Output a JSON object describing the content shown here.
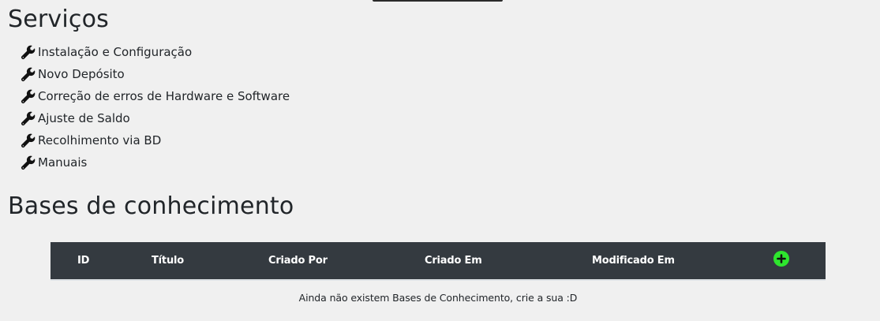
{
  "services": {
    "title": "Serviços",
    "items": [
      {
        "label": "Instalação e Configuração",
        "icon": "wrench-icon"
      },
      {
        "label": "Novo Depósito",
        "icon": "wrench-icon"
      },
      {
        "label": "Correção de erros de Hardware e Software",
        "icon": "wrench-icon"
      },
      {
        "label": "Ajuste de Saldo",
        "icon": "wrench-icon"
      },
      {
        "label": "Recolhimento via BD",
        "icon": "wrench-icon"
      },
      {
        "label": "Manuais",
        "icon": "wrench-icon"
      }
    ]
  },
  "knowledge_base": {
    "title": "Bases de conhecimento",
    "columns": [
      "ID",
      "Título",
      "Criado Por",
      "Criado Em",
      "Modificado Em"
    ],
    "add_icon": "plus-circle-icon",
    "empty_message": "Ainda não existem Bases de Conhecimento, crie a sua :D"
  },
  "colors": {
    "page_background": "#f0f0f0",
    "table_header_background": "#343a40",
    "add_button": "#2ee52e",
    "text": "#212529"
  }
}
